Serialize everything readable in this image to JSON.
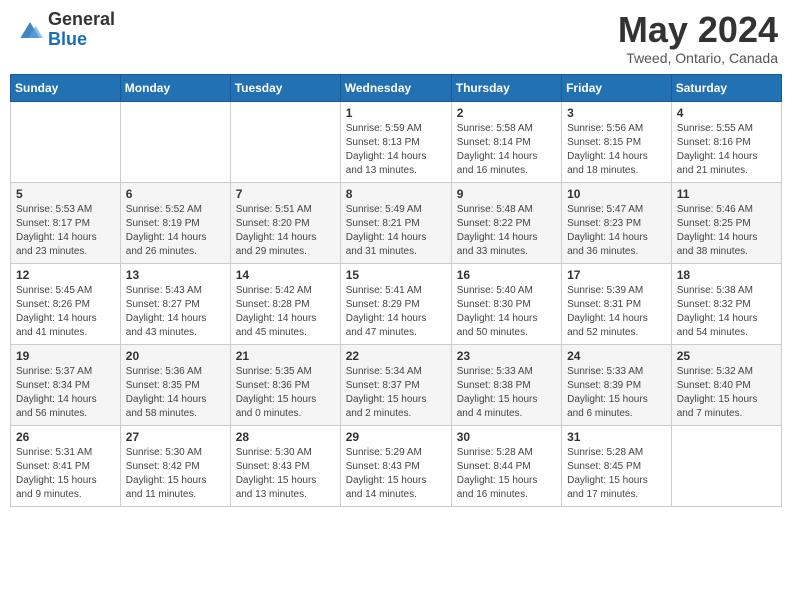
{
  "header": {
    "logo_general": "General",
    "logo_blue": "Blue",
    "month_title": "May 2024",
    "location": "Tweed, Ontario, Canada"
  },
  "weekdays": [
    "Sunday",
    "Monday",
    "Tuesday",
    "Wednesday",
    "Thursday",
    "Friday",
    "Saturday"
  ],
  "weeks": [
    [
      {
        "day": "",
        "info": ""
      },
      {
        "day": "",
        "info": ""
      },
      {
        "day": "",
        "info": ""
      },
      {
        "day": "1",
        "info": "Sunrise: 5:59 AM\nSunset: 8:13 PM\nDaylight: 14 hours and 13 minutes."
      },
      {
        "day": "2",
        "info": "Sunrise: 5:58 AM\nSunset: 8:14 PM\nDaylight: 14 hours and 16 minutes."
      },
      {
        "day": "3",
        "info": "Sunrise: 5:56 AM\nSunset: 8:15 PM\nDaylight: 14 hours and 18 minutes."
      },
      {
        "day": "4",
        "info": "Sunrise: 5:55 AM\nSunset: 8:16 PM\nDaylight: 14 hours and 21 minutes."
      }
    ],
    [
      {
        "day": "5",
        "info": "Sunrise: 5:53 AM\nSunset: 8:17 PM\nDaylight: 14 hours and 23 minutes."
      },
      {
        "day": "6",
        "info": "Sunrise: 5:52 AM\nSunset: 8:19 PM\nDaylight: 14 hours and 26 minutes."
      },
      {
        "day": "7",
        "info": "Sunrise: 5:51 AM\nSunset: 8:20 PM\nDaylight: 14 hours and 29 minutes."
      },
      {
        "day": "8",
        "info": "Sunrise: 5:49 AM\nSunset: 8:21 PM\nDaylight: 14 hours and 31 minutes."
      },
      {
        "day": "9",
        "info": "Sunrise: 5:48 AM\nSunset: 8:22 PM\nDaylight: 14 hours and 33 minutes."
      },
      {
        "day": "10",
        "info": "Sunrise: 5:47 AM\nSunset: 8:23 PM\nDaylight: 14 hours and 36 minutes."
      },
      {
        "day": "11",
        "info": "Sunrise: 5:46 AM\nSunset: 8:25 PM\nDaylight: 14 hours and 38 minutes."
      }
    ],
    [
      {
        "day": "12",
        "info": "Sunrise: 5:45 AM\nSunset: 8:26 PM\nDaylight: 14 hours and 41 minutes."
      },
      {
        "day": "13",
        "info": "Sunrise: 5:43 AM\nSunset: 8:27 PM\nDaylight: 14 hours and 43 minutes."
      },
      {
        "day": "14",
        "info": "Sunrise: 5:42 AM\nSunset: 8:28 PM\nDaylight: 14 hours and 45 minutes."
      },
      {
        "day": "15",
        "info": "Sunrise: 5:41 AM\nSunset: 8:29 PM\nDaylight: 14 hours and 47 minutes."
      },
      {
        "day": "16",
        "info": "Sunrise: 5:40 AM\nSunset: 8:30 PM\nDaylight: 14 hours and 50 minutes."
      },
      {
        "day": "17",
        "info": "Sunrise: 5:39 AM\nSunset: 8:31 PM\nDaylight: 14 hours and 52 minutes."
      },
      {
        "day": "18",
        "info": "Sunrise: 5:38 AM\nSunset: 8:32 PM\nDaylight: 14 hours and 54 minutes."
      }
    ],
    [
      {
        "day": "19",
        "info": "Sunrise: 5:37 AM\nSunset: 8:34 PM\nDaylight: 14 hours and 56 minutes."
      },
      {
        "day": "20",
        "info": "Sunrise: 5:36 AM\nSunset: 8:35 PM\nDaylight: 14 hours and 58 minutes."
      },
      {
        "day": "21",
        "info": "Sunrise: 5:35 AM\nSunset: 8:36 PM\nDaylight: 15 hours and 0 minutes."
      },
      {
        "day": "22",
        "info": "Sunrise: 5:34 AM\nSunset: 8:37 PM\nDaylight: 15 hours and 2 minutes."
      },
      {
        "day": "23",
        "info": "Sunrise: 5:33 AM\nSunset: 8:38 PM\nDaylight: 15 hours and 4 minutes."
      },
      {
        "day": "24",
        "info": "Sunrise: 5:33 AM\nSunset: 8:39 PM\nDaylight: 15 hours and 6 minutes."
      },
      {
        "day": "25",
        "info": "Sunrise: 5:32 AM\nSunset: 8:40 PM\nDaylight: 15 hours and 7 minutes."
      }
    ],
    [
      {
        "day": "26",
        "info": "Sunrise: 5:31 AM\nSunset: 8:41 PM\nDaylight: 15 hours and 9 minutes."
      },
      {
        "day": "27",
        "info": "Sunrise: 5:30 AM\nSunset: 8:42 PM\nDaylight: 15 hours and 11 minutes."
      },
      {
        "day": "28",
        "info": "Sunrise: 5:30 AM\nSunset: 8:43 PM\nDaylight: 15 hours and 13 minutes."
      },
      {
        "day": "29",
        "info": "Sunrise: 5:29 AM\nSunset: 8:43 PM\nDaylight: 15 hours and 14 minutes."
      },
      {
        "day": "30",
        "info": "Sunrise: 5:28 AM\nSunset: 8:44 PM\nDaylight: 15 hours and 16 minutes."
      },
      {
        "day": "31",
        "info": "Sunrise: 5:28 AM\nSunset: 8:45 PM\nDaylight: 15 hours and 17 minutes."
      },
      {
        "day": "",
        "info": ""
      }
    ]
  ]
}
